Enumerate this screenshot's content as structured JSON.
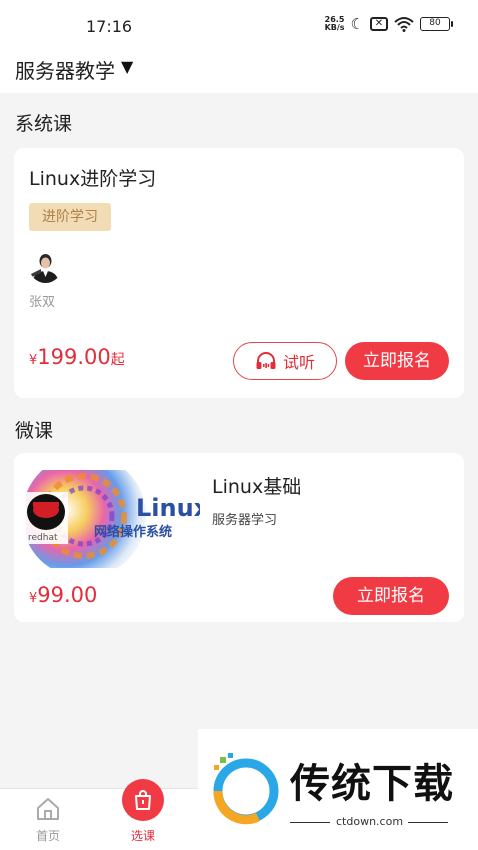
{
  "status_bar": {
    "time": "17:16",
    "net_speed_value": "26.5",
    "net_speed_unit": "KB/s",
    "battery": "80"
  },
  "header": {
    "category": "服务器教学"
  },
  "system_section": {
    "title": "系统课",
    "course": {
      "title": "Linux进阶学习",
      "tag": "进阶学习",
      "teacher": "张双",
      "price_symbol": "¥",
      "price": "199.00",
      "price_suffix": "起",
      "trial_label": "试听",
      "enroll_label": "立即报名"
    }
  },
  "micro_section": {
    "title": "微课",
    "course": {
      "title": "Linux基础",
      "subtitle": "服务器学习",
      "price_symbol": "¥",
      "price": "99.00",
      "enroll_label": "立即报名",
      "thumbnail": {
        "brand": "redhat",
        "big": "Linux",
        "caption": "网络操作系统"
      }
    }
  },
  "bottom_nav": {
    "items": [
      {
        "label": "首页",
        "icon": "home-icon"
      },
      {
        "label": "选课",
        "icon": "shopping-bag-icon"
      }
    ]
  },
  "watermark": {
    "text": "传统下载",
    "url": "ctdown.com"
  },
  "colors": {
    "accent": "#f03b45",
    "price": "#e32d39",
    "tag_bg": "#f1dcb6",
    "tag_text": "#b0814a"
  }
}
